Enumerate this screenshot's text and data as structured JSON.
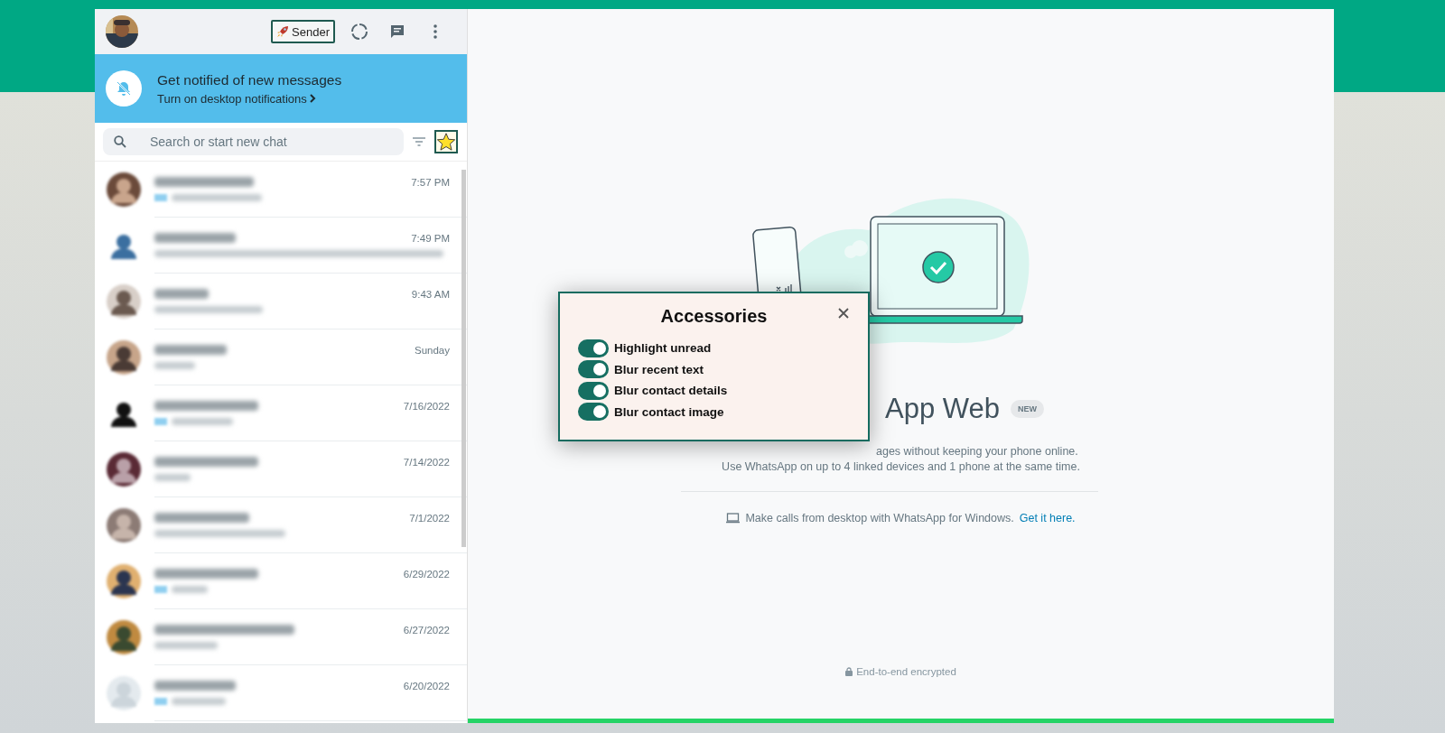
{
  "header": {
    "sender_button": "Sender"
  },
  "notification_banner": {
    "title": "Get notified of new messages",
    "link": "Turn on desktop notifications"
  },
  "search": {
    "placeholder": "Search or start new chat"
  },
  "chats": [
    {
      "time": "7:57 PM",
      "ticked": true
    },
    {
      "time": "7:49 PM",
      "ticked": false
    },
    {
      "time": "9:43 AM",
      "ticked": false
    },
    {
      "time": "Sunday",
      "ticked": false
    },
    {
      "time": "7/16/2022",
      "ticked": true
    },
    {
      "time": "7/14/2022",
      "ticked": false
    },
    {
      "time": "7/1/2022",
      "ticked": false
    },
    {
      "time": "6/29/2022",
      "ticked": true
    },
    {
      "time": "6/27/2022",
      "ticked": false
    },
    {
      "time": "6/20/2022",
      "ticked": true
    }
  ],
  "welcome": {
    "title": "App Web",
    "badge": "NEW",
    "lines": [
      "ages without keeping your phone online.",
      "Use WhatsApp on up to 4 linked devices and 1 phone at the same time."
    ],
    "calls_text": "Make calls from desktop with WhatsApp for Windows.",
    "calls_link": "Get it here.",
    "footer": "End-to-end encrypted"
  },
  "popup": {
    "title": "Accessories",
    "toggles": [
      {
        "label": "Highlight unread",
        "on": true
      },
      {
        "label": "Blur recent text",
        "on": true
      },
      {
        "label": "Blur contact details",
        "on": true
      },
      {
        "label": "Blur contact image",
        "on": true
      }
    ]
  }
}
